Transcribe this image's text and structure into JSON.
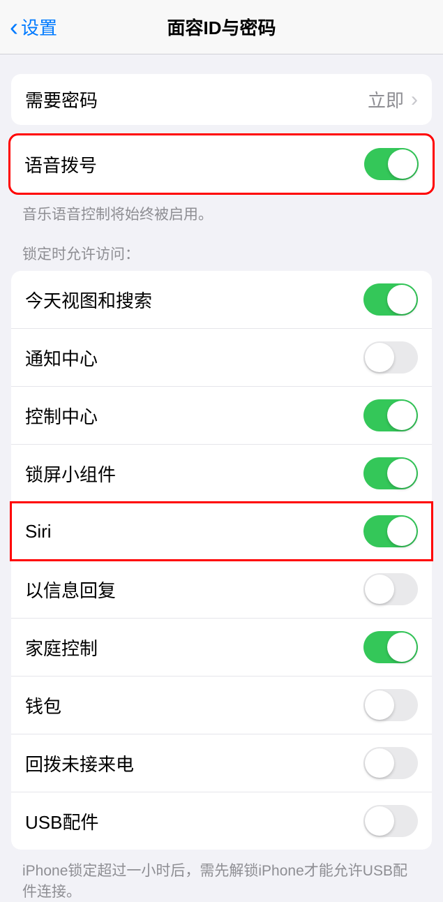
{
  "nav": {
    "back_label": "设置",
    "title": "面容ID与密码"
  },
  "passcode_row": {
    "label": "需要密码",
    "value": "立即"
  },
  "voice_dial": {
    "label": "语音拨号",
    "footer": "音乐语音控制将始终被启用。"
  },
  "lock_header": "锁定时允许访问：",
  "lock_items": [
    {
      "label": "今天视图和搜索",
      "on": true
    },
    {
      "label": "通知中心",
      "on": false
    },
    {
      "label": "控制中心",
      "on": true
    },
    {
      "label": "锁屏小组件",
      "on": true
    },
    {
      "label": "Siri",
      "on": true
    },
    {
      "label": "以信息回复",
      "on": false
    },
    {
      "label": "家庭控制",
      "on": true
    },
    {
      "label": "钱包",
      "on": false
    },
    {
      "label": "回拨未接来电",
      "on": false
    },
    {
      "label": "USB配件",
      "on": false
    }
  ],
  "usb_footer": "iPhone锁定超过一小时后，需先解锁iPhone才能允许USB配件连接。"
}
